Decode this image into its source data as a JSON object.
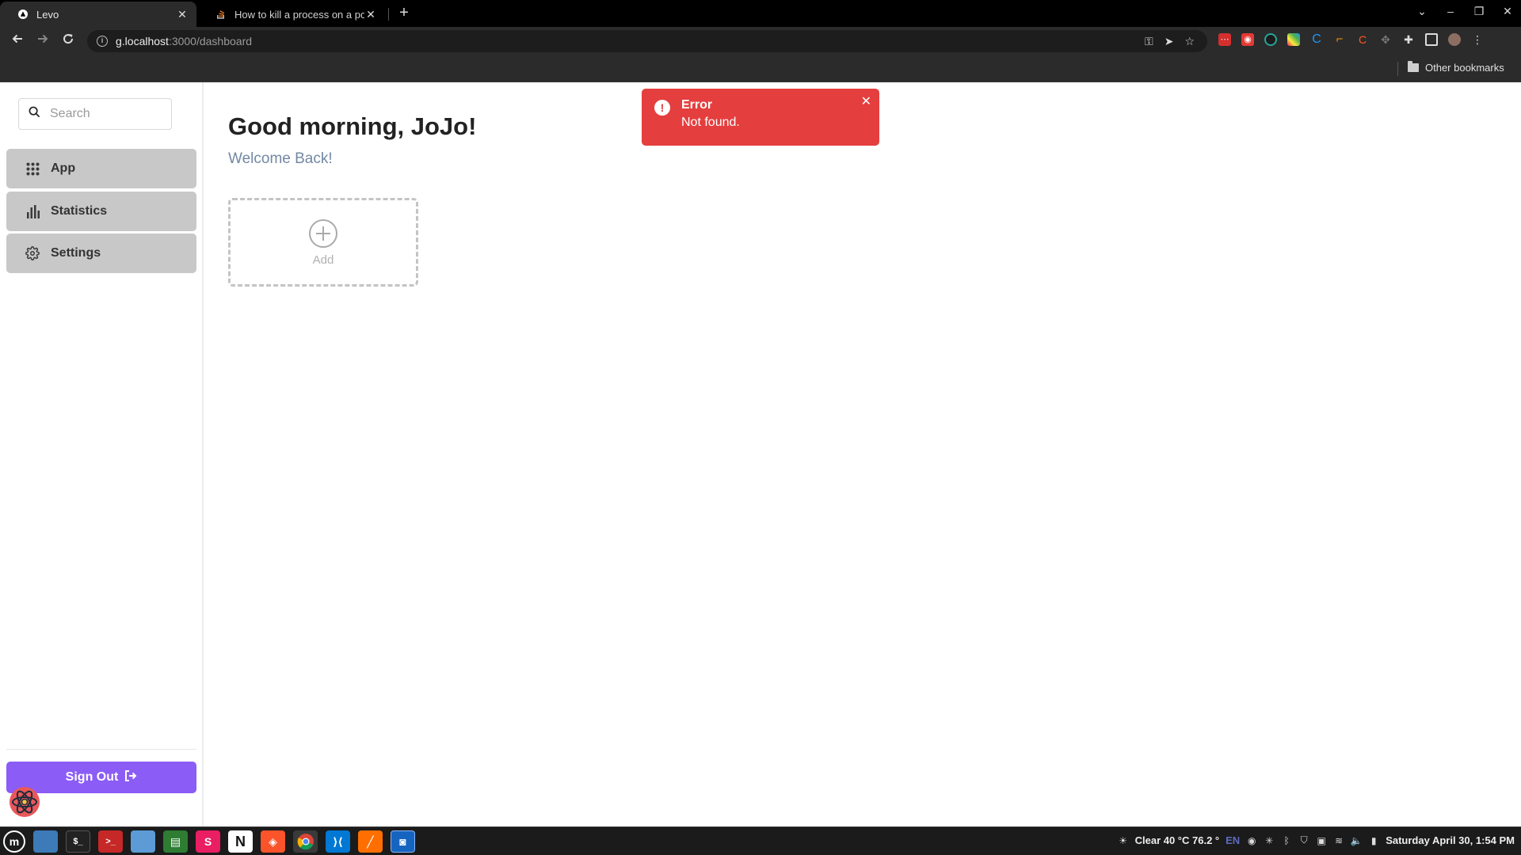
{
  "browser": {
    "tabs": [
      {
        "title": "Levo",
        "active": true
      },
      {
        "title": "How to kill a process on a port",
        "active": false
      }
    ],
    "url": {
      "host": "g.localhost",
      "path": ":3000/dashboard"
    },
    "bookmarks": {
      "other_label": "Other bookmarks"
    }
  },
  "sidebar": {
    "search_placeholder": "Search",
    "items": [
      {
        "label": "App",
        "icon": "grid-icon"
      },
      {
        "label": "Statistics",
        "icon": "bar-chart-icon"
      },
      {
        "label": "Settings",
        "icon": "gear-icon"
      }
    ],
    "signout_label": "Sign Out"
  },
  "main": {
    "greeting": "Good morning, JoJo!",
    "subtitle": "Welcome Back!",
    "add_label": "Add"
  },
  "toast": {
    "title": "Error",
    "message": "Not found."
  },
  "taskbar": {
    "weather": "Clear 40 °C 76.2 °",
    "lang": "EN",
    "datetime": "Saturday April 30,  1:54 PM"
  },
  "colors": {
    "accent": "#8b5cf6",
    "error": "#e53e3e",
    "nav_item_bg": "#c8c8c8",
    "subtitle": "#7388a3"
  }
}
